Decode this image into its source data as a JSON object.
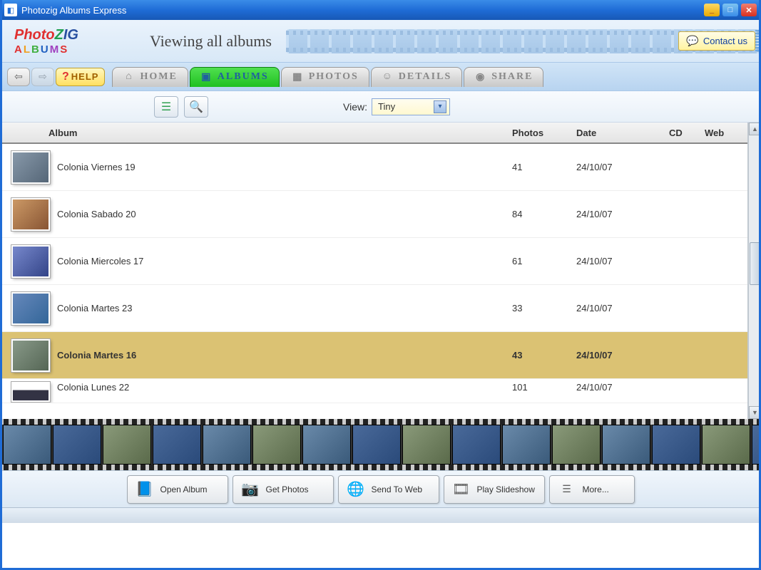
{
  "titlebar": {
    "title": "Photozig Albums Express"
  },
  "header": {
    "page_title": "Viewing all albums",
    "contact_label": "Contact us"
  },
  "nav": {
    "help_label": "HELP",
    "tabs": [
      {
        "label": "HOME",
        "icon": "home"
      },
      {
        "label": "ALBUMS",
        "icon": "albums"
      },
      {
        "label": "PHOTOS",
        "icon": "grid"
      },
      {
        "label": "DETAILS",
        "icon": "person"
      },
      {
        "label": "SHARE",
        "icon": "globe"
      }
    ],
    "active_tab": 1
  },
  "toolbar": {
    "view_label": "View:",
    "view_value": "Tiny"
  },
  "table": {
    "columns": {
      "album": "Album",
      "photos": "Photos",
      "date": "Date",
      "cd": "CD",
      "web": "Web"
    },
    "rows": [
      {
        "album": "Colonia Viernes 19",
        "photos": "41",
        "date": "24/10/07",
        "cd": "",
        "web": "",
        "selected": false
      },
      {
        "album": "Colonia Sabado 20",
        "photos": "84",
        "date": "24/10/07",
        "cd": "",
        "web": "",
        "selected": false
      },
      {
        "album": "Colonia Miercoles 17",
        "photos": "61",
        "date": "24/10/07",
        "cd": "",
        "web": "",
        "selected": false
      },
      {
        "album": "Colonia Martes 23",
        "photos": "33",
        "date": "24/10/07",
        "cd": "",
        "web": "",
        "selected": false
      },
      {
        "album": "Colonia Martes 16",
        "photos": "43",
        "date": "24/10/07",
        "cd": "",
        "web": "",
        "selected": true
      },
      {
        "album": "Colonia Lunes 22",
        "photos": "101",
        "date": "24/10/07",
        "cd": "",
        "web": "",
        "selected": false
      }
    ]
  },
  "actions": {
    "open_album": "Open Album",
    "get_photos": "Get Photos",
    "send_web": "Send To Web",
    "play_slideshow": "Play Slideshow",
    "more": "More..."
  }
}
